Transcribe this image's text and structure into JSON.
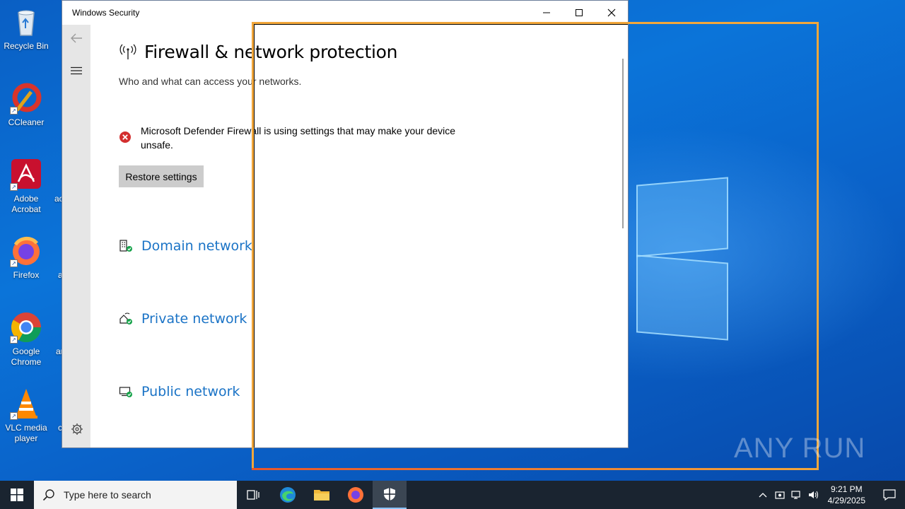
{
  "desktop": {
    "icons": [
      {
        "label": "Recycle Bin"
      },
      {
        "label": "CCleaner"
      },
      {
        "label": "Adobe Acrobat"
      },
      {
        "label": "Firefox"
      },
      {
        "label": "Google Chrome"
      },
      {
        "label": "VLC media player"
      }
    ],
    "partial_labels": [
      "ac",
      "a",
      "ar",
      "c"
    ]
  },
  "window": {
    "title": "Windows Security",
    "page_title": "Firewall & network protection",
    "subtitle": "Who and what can access your networks.",
    "alert_text": "Microsoft Defender Firewall is using settings that may make your device unsafe.",
    "restore_button": "Restore settings",
    "networks": [
      {
        "label": "Domain network",
        "icon": "domain-network-icon"
      },
      {
        "label": "Private network",
        "icon": "private-network-icon"
      },
      {
        "label": "Public network",
        "icon": "public-network-icon"
      }
    ]
  },
  "watermark": "ANY RUN",
  "taskbar": {
    "search_placeholder": "Type here to search",
    "time": "9:21 PM",
    "date": "4/29/2025"
  },
  "colors": {
    "link": "#1a73c6",
    "alert_red": "#d32f2f",
    "status_green": "#16a34a",
    "highlight_orange": "#f2a73b"
  }
}
